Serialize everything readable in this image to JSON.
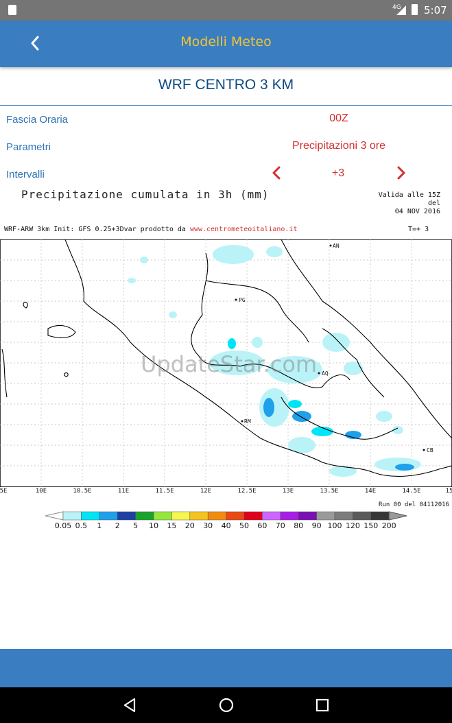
{
  "status_bar": {
    "network": "4G",
    "time": "5:07"
  },
  "app_bar": {
    "title": "Modelli Meteo",
    "back_icon": "chevron-left-icon"
  },
  "heading": "WRF CENTRO 3 KM",
  "rows": {
    "fascia_label": "Fascia Oraria",
    "fascia_value": "00Z",
    "parametri_label": "Parametri",
    "parametri_value": "Precipitazioni 3 ore",
    "intervalli_label": "Intervalli",
    "intervalli_value": "+3"
  },
  "map": {
    "title": "Precipitazione cumulata in 3h (mm)",
    "valida_line1": "Valida alle 15Z del",
    "valida_line2": "04 NOV 2016",
    "info_prefix": "WRF-ARW 3km Init: GFS 0.25+3Dvar prodotto da",
    "info_link": "www.centrometeoitaliano.it",
    "timestep": "T=+ 3",
    "run": "Run 00 del 04112016",
    "x_ticks": [
      "5E",
      "10E",
      "10.5E",
      "11E",
      "11.5E",
      "12E",
      "12.5E",
      "13E",
      "13.5E",
      "14E",
      "14.5E",
      "15"
    ],
    "cities": [
      "AN",
      "PG",
      "AQ",
      "RM",
      "CB"
    ],
    "watermark": "UpdateStar.com"
  },
  "legend": {
    "labels": [
      "0.05",
      "0.5",
      "1",
      "2",
      "5",
      "10",
      "15",
      "20",
      "30",
      "40",
      "50",
      "60",
      "70",
      "80",
      "90",
      "100",
      "120",
      "150",
      "200"
    ],
    "colors": [
      "#b9f3f7",
      "#00e5f5",
      "#1ea0ea",
      "#1d3fa8",
      "#1aa32a",
      "#96e63c",
      "#f6f650",
      "#f5c31d",
      "#f28c0f",
      "#eb4814",
      "#e1001c",
      "#cc66ff",
      "#a81ee6",
      "#7a0fb4",
      "#9a9a9a",
      "#7c7c7c",
      "#5a5a5a",
      "#363636"
    ]
  },
  "nav_bar": {
    "back_icon": "nav-back-icon",
    "home_icon": "nav-home-icon",
    "recents_icon": "nav-recents-icon"
  }
}
